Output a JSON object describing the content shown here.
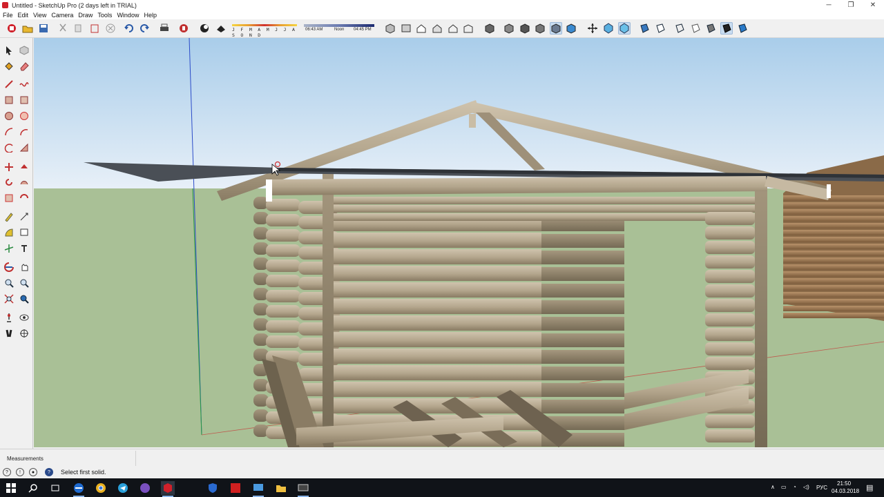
{
  "window": {
    "title": "Untitled - SketchUp Pro (2 days left in TRIAL)",
    "controls": {
      "minimize": "─",
      "restore": "❐",
      "close": "✕"
    }
  },
  "menu": [
    "File",
    "Edit",
    "View",
    "Camera",
    "Draw",
    "Tools",
    "Window",
    "Help"
  ],
  "shadows": {
    "months": "J F M A M J J A S O N D",
    "time_start": "06:43 AM",
    "time_mid": "Noon",
    "time_end": "04:45 PM"
  },
  "measurements": {
    "label": "Measurements",
    "value": ""
  },
  "status": {
    "text": "Select first solid."
  },
  "taskbar": {
    "language": "РУС",
    "time": "21:50",
    "date": "04.03.2018"
  },
  "colors": {
    "sky_top": "#a9cdea",
    "sky_bottom": "#e8f0f8",
    "ground": "#a9c096",
    "log": "#b8aa92",
    "log_dark": "#8c7e68",
    "roof_sheet": "#555a60",
    "accent_red": "#d0202a"
  }
}
